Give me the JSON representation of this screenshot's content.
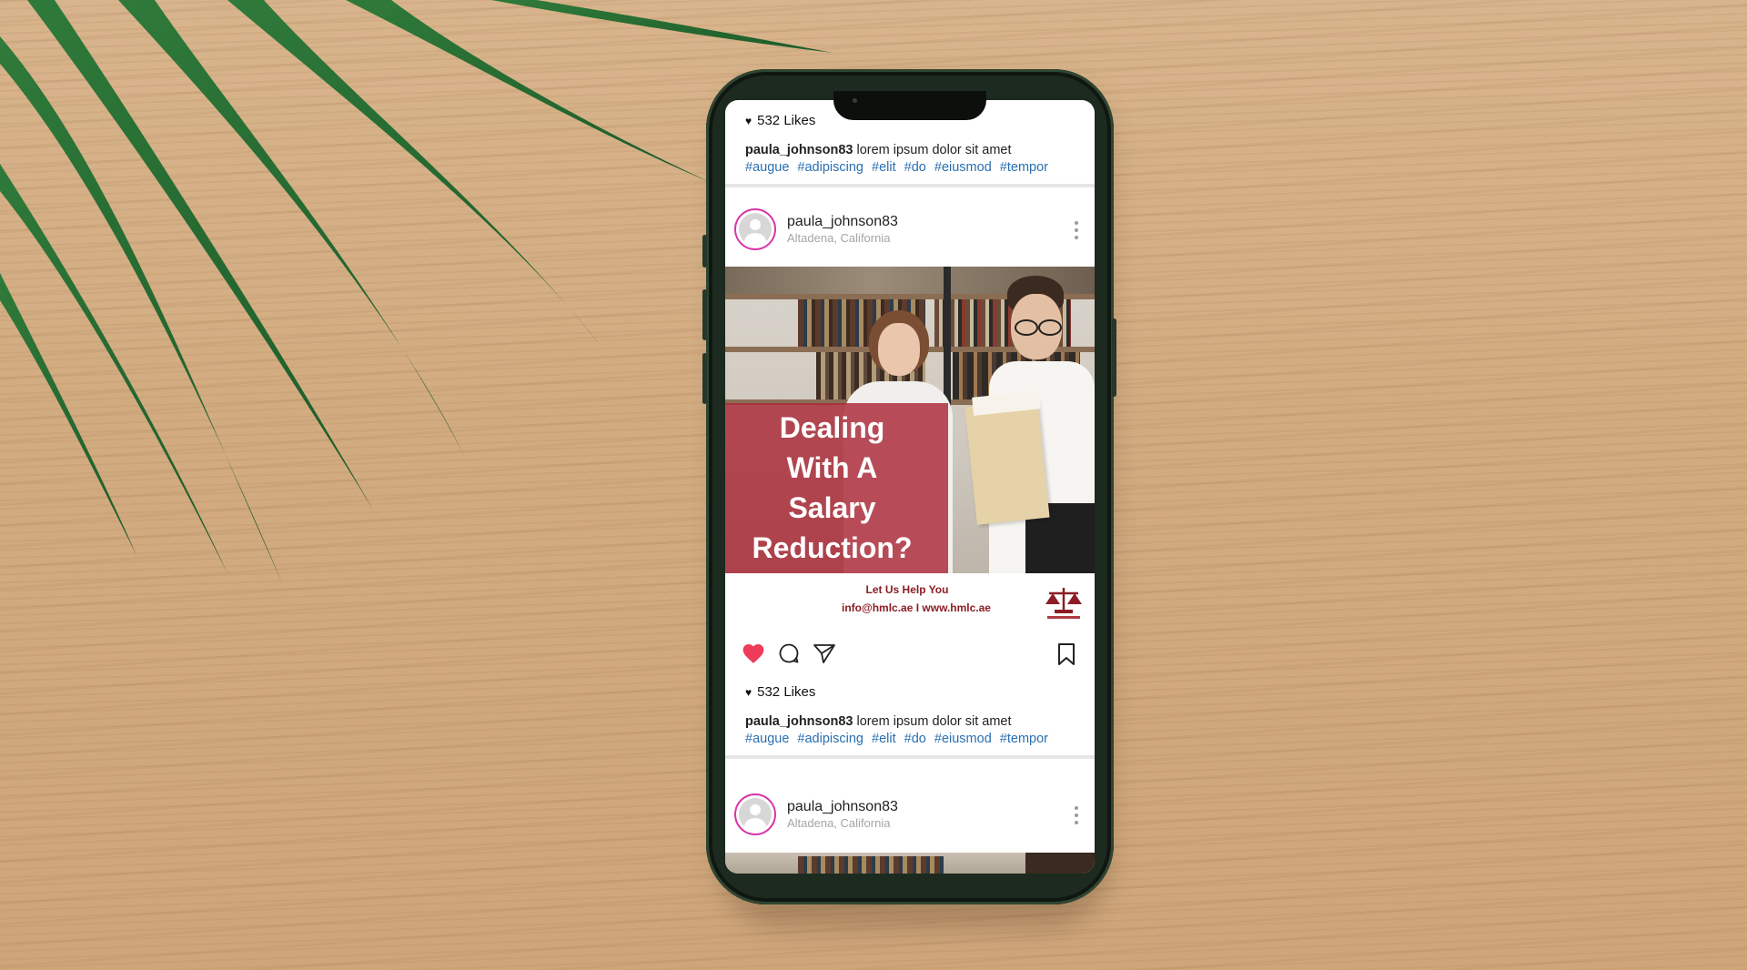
{
  "feed": {
    "top_post": {
      "likes": "532 Likes",
      "caption_user": "paula_johnson83",
      "caption_text": " lorem ipsum dolor sit amet",
      "hashtags": [
        "#augue",
        "#adipiscing",
        "#elit",
        "#do",
        "#eiusmod",
        "#tempor"
      ]
    },
    "main_post": {
      "username": "paula_johnson83",
      "location": "Altadena, California",
      "image_headline": [
        "Dealing",
        "With A",
        "Salary",
        "Reduction?"
      ],
      "banner_line1": "Let Us Help You",
      "banner_line2": "info@hmlc.ae  I  www.hmlc.ae",
      "liked": true,
      "likes": "532 Likes",
      "caption_user": "paula_johnson83",
      "caption_text": " lorem ipsum dolor sit amet",
      "hashtags": [
        "#augue",
        "#adipiscing",
        "#elit",
        "#do",
        "#eiusmod",
        "#tempor"
      ]
    },
    "next_post": {
      "username": "paula_johnson83",
      "location": "Altadena, California"
    }
  },
  "icons": {
    "like": "heart-icon",
    "comment": "comment-icon",
    "share": "send-icon",
    "save": "bookmark-icon",
    "more": "more-vertical-icon"
  },
  "colors": {
    "like_red": "#ee3b5a",
    "hashtag_blue": "#2a6fb0",
    "avatar_ring": "#d936a6",
    "brand_maroon": "#8b1d24",
    "phone_frame": "#1c2a1f"
  }
}
